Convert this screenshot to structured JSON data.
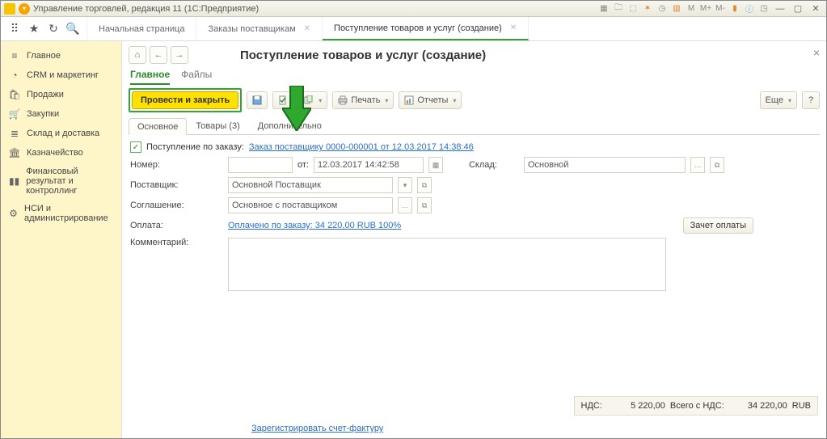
{
  "titlebar": {
    "title": "Управление торговлей, редакция 11  (1С:Предприятие)",
    "m_items": [
      "M",
      "M+",
      "M-"
    ]
  },
  "topnav": {
    "tabs": [
      {
        "label": "Начальная страница",
        "closable": false
      },
      {
        "label": "Заказы поставщикам",
        "closable": true
      },
      {
        "label": "Поступление товаров и услуг (создание)",
        "closable": true,
        "active": true
      }
    ]
  },
  "sidebar": {
    "items": [
      {
        "icon": "menu",
        "label": "Главное"
      },
      {
        "icon": "pie",
        "label": "CRM и маркетинг"
      },
      {
        "icon": "bag",
        "label": "Продажи"
      },
      {
        "icon": "cart",
        "label": "Закупки"
      },
      {
        "icon": "rows",
        "label": "Склад и доставка"
      },
      {
        "icon": "bank",
        "label": "Казначейство"
      },
      {
        "icon": "bars",
        "label": "Финансовый результат и контроллинг"
      },
      {
        "icon": "gear",
        "label": "НСИ и администрирование"
      }
    ]
  },
  "page": {
    "title": "Поступление товаров и услуг (создание)",
    "view_tabs": {
      "main": "Главное",
      "files": "Файлы"
    }
  },
  "toolbar": {
    "provesti": "Провести и закрыть",
    "print": "Печать",
    "reports": "Отчеты",
    "more": "Еще"
  },
  "subtabs": {
    "main": "Основное",
    "goods": "Товары (3)",
    "extra": "Дополнительно"
  },
  "form": {
    "order_label": "Поступление по заказу:",
    "order_link": "Заказ поставщику 0000-000001 от 12.03.2017 14:38:46",
    "number_label": "Номер:",
    "number": "",
    "from_label": "от:",
    "date": "12.03.2017 14:42:58",
    "warehouse_label": "Склад:",
    "warehouse": "Основной",
    "supplier_label": "Поставщик:",
    "supplier": "Основной Поставщик",
    "agreement_label": "Соглашение:",
    "agreement": "Основное с поставщиком",
    "payment_label": "Оплата:",
    "payment_link": "Оплачено по заказу: 34 220,00 RUB  100%",
    "offset_btn": "Зачет оплаты",
    "comment_label": "Комментарий:"
  },
  "footer": {
    "nds_label": "НДС:",
    "nds_value": "5 220,00",
    "total_label": "Всего с НДС:",
    "total_value": "34 220,00",
    "currency": "RUB"
  },
  "bottom": {
    "invoice_link": "Зарегистрировать счет-фактуру"
  }
}
